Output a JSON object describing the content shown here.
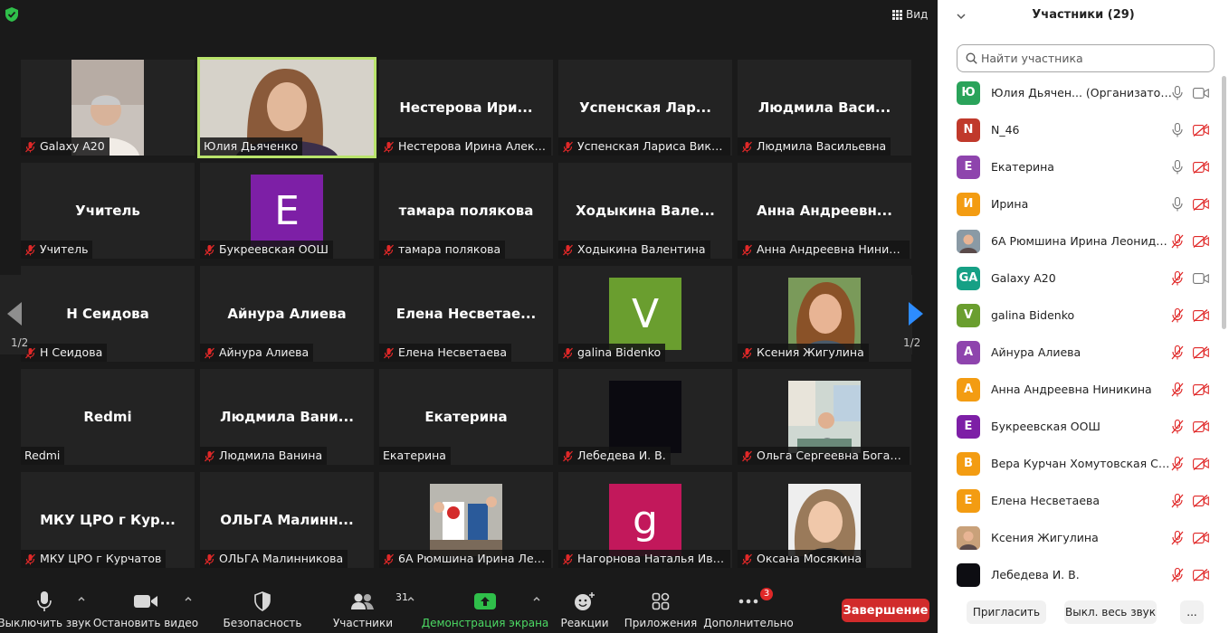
{
  "meeting": {
    "view_label": "Вид",
    "page_left": "1/2",
    "page_right": "1/2",
    "tiles": [
      {
        "label": "Galaxy A20",
        "big": "",
        "muted": true,
        "kind": "photo",
        "photo": "p1"
      },
      {
        "label": "Юлия Дьяченко",
        "big": "",
        "muted": false,
        "kind": "photo",
        "photo": "p2",
        "active": true
      },
      {
        "label": "Нестерова Ирина Алексе...",
        "big": "Нестерова  Ири...",
        "muted": true,
        "kind": "name"
      },
      {
        "label": "Успенская Лариса Виктор...",
        "big": "Успенская  Лар...",
        "muted": true,
        "kind": "name"
      },
      {
        "label": "Людмила Васильевна",
        "big": "Людмила  Васи...",
        "muted": true,
        "kind": "name"
      },
      {
        "label": "Учитель",
        "big": "Учитель",
        "muted": true,
        "kind": "name"
      },
      {
        "label": "Букреевская ООШ",
        "big": "",
        "muted": true,
        "kind": "letter",
        "letter": "E",
        "color": "#7d1fa6"
      },
      {
        "label": "тамара полякова",
        "big": "тамара полякова",
        "muted": true,
        "kind": "name"
      },
      {
        "label": "Ходыкина Валентина",
        "big": "Ходыкина  Вале...",
        "muted": true,
        "kind": "name"
      },
      {
        "label": "Анна Андреевна Ниникина",
        "big": "Анна  Андреевн...",
        "muted": true,
        "kind": "name"
      },
      {
        "label": "Н Сеидова",
        "big": "Н Сеидова",
        "muted": true,
        "kind": "name"
      },
      {
        "label": "Айнура Алиева",
        "big": "Айнура Алиева",
        "muted": true,
        "kind": "name"
      },
      {
        "label": "Елена Несветаева",
        "big": "Елена  Несветае...",
        "muted": true,
        "kind": "name"
      },
      {
        "label": "galina Bidenko",
        "big": "",
        "muted": true,
        "kind": "letter",
        "letter": "V",
        "color": "#6a9e2f"
      },
      {
        "label": "Ксения Жигулина",
        "big": "",
        "muted": true,
        "kind": "photo",
        "photo": "p3"
      },
      {
        "label": "Redmi",
        "big": "Redmi",
        "muted": false,
        "kind": "name"
      },
      {
        "label": "Людмила Ванина",
        "big": "Людмила  Вани...",
        "muted": true,
        "kind": "name"
      },
      {
        "label": "Екатерина",
        "big": "Екатерина",
        "muted": false,
        "kind": "name"
      },
      {
        "label": "Лебедева И. В.",
        "big": "",
        "muted": true,
        "kind": "dark"
      },
      {
        "label": "Ольга Сергеевна Богачева",
        "big": "",
        "muted": true,
        "kind": "photo",
        "photo": "p4"
      },
      {
        "label": "МКУ ЦРО г Курчатов",
        "big": "МКУ ЦРО г Кур...",
        "muted": true,
        "kind": "name"
      },
      {
        "label": "ОЛЬГА Малинникова",
        "big": "ОЛЬГА  Малинн...",
        "muted": true,
        "kind": "name"
      },
      {
        "label": "6А Рюмшина Ирина Леон...",
        "big": "",
        "muted": true,
        "kind": "photo",
        "photo": "p5"
      },
      {
        "label": "Нагорнова Наталья Иван...",
        "big": "",
        "muted": true,
        "kind": "letter",
        "letter": "g",
        "color": "#c2185b"
      },
      {
        "label": "Оксана Мосякина",
        "big": "",
        "muted": true,
        "kind": "photo",
        "photo": "p6"
      }
    ]
  },
  "toolbar": {
    "mute": "Выключить звук",
    "video": "Остановить видео",
    "security": "Безопасность",
    "participants": "Участники",
    "participants_count": "31",
    "share": "Демонстрация экрана",
    "reactions": "Реакции",
    "apps": "Приложения",
    "more": "Дополнительно",
    "more_badge": "3",
    "end": "Завершение"
  },
  "panel": {
    "title": "Участники (29)",
    "search_placeholder": "Найти участника",
    "participants": [
      {
        "initial": "Ю",
        "color": "#2aa35a",
        "name": "Юлия Дьячен... (Организатор, я)",
        "mic": "on",
        "cam": "on"
      },
      {
        "initial": "N",
        "color": "#c0392b",
        "name": "N_46",
        "mic": "on",
        "cam": "off"
      },
      {
        "initial": "E",
        "color": "#8e44ad",
        "name": "Екатерина",
        "mic": "on",
        "cam": "off"
      },
      {
        "initial": "И",
        "color": "#f39c12",
        "name": "Ирина",
        "mic": "on",
        "cam": "off"
      },
      {
        "initial": "",
        "color": "#8a9aa5",
        "name": "6А Рюмшина Ирина Леонидов...",
        "mic": "off",
        "cam": "off",
        "photo": true
      },
      {
        "initial": "GA",
        "color": "#16a085",
        "name": "Galaxy A20",
        "mic": "off",
        "cam": "on"
      },
      {
        "initial": "V",
        "color": "#6a9e2f",
        "name": "galina Bidenko",
        "mic": "off",
        "cam": "off"
      },
      {
        "initial": "А",
        "color": "#8e44ad",
        "name": "Айнура Алиева",
        "mic": "off",
        "cam": "off"
      },
      {
        "initial": "А",
        "color": "#f39c12",
        "name": "Анна Андреевна Ниникина",
        "mic": "off",
        "cam": "off"
      },
      {
        "initial": "E",
        "color": "#7d1fa6",
        "name": "Букреевская ООШ",
        "mic": "off",
        "cam": "off"
      },
      {
        "initial": "В",
        "color": "#f39c12",
        "name": "Вера Курчан Хомутовская СОШ",
        "mic": "off",
        "cam": "off"
      },
      {
        "initial": "Е",
        "color": "#f39c12",
        "name": "Елена Несветаева",
        "mic": "off",
        "cam": "off"
      },
      {
        "initial": "",
        "color": "#c9a17a",
        "name": "Ксения Жигулина",
        "mic": "off",
        "cam": "off",
        "photo": true
      },
      {
        "initial": "",
        "color": "#0d0d12",
        "name": "Лебедева И. В.",
        "mic": "off",
        "cam": "off"
      }
    ],
    "invite": "Пригласить",
    "mute_all": "Выкл. весь звук",
    "more": "..."
  },
  "colors": {
    "accent": "#2d8cff",
    "active_speaker": "#b9e36b",
    "end": "#d12b2b",
    "share": "#4cd964"
  }
}
